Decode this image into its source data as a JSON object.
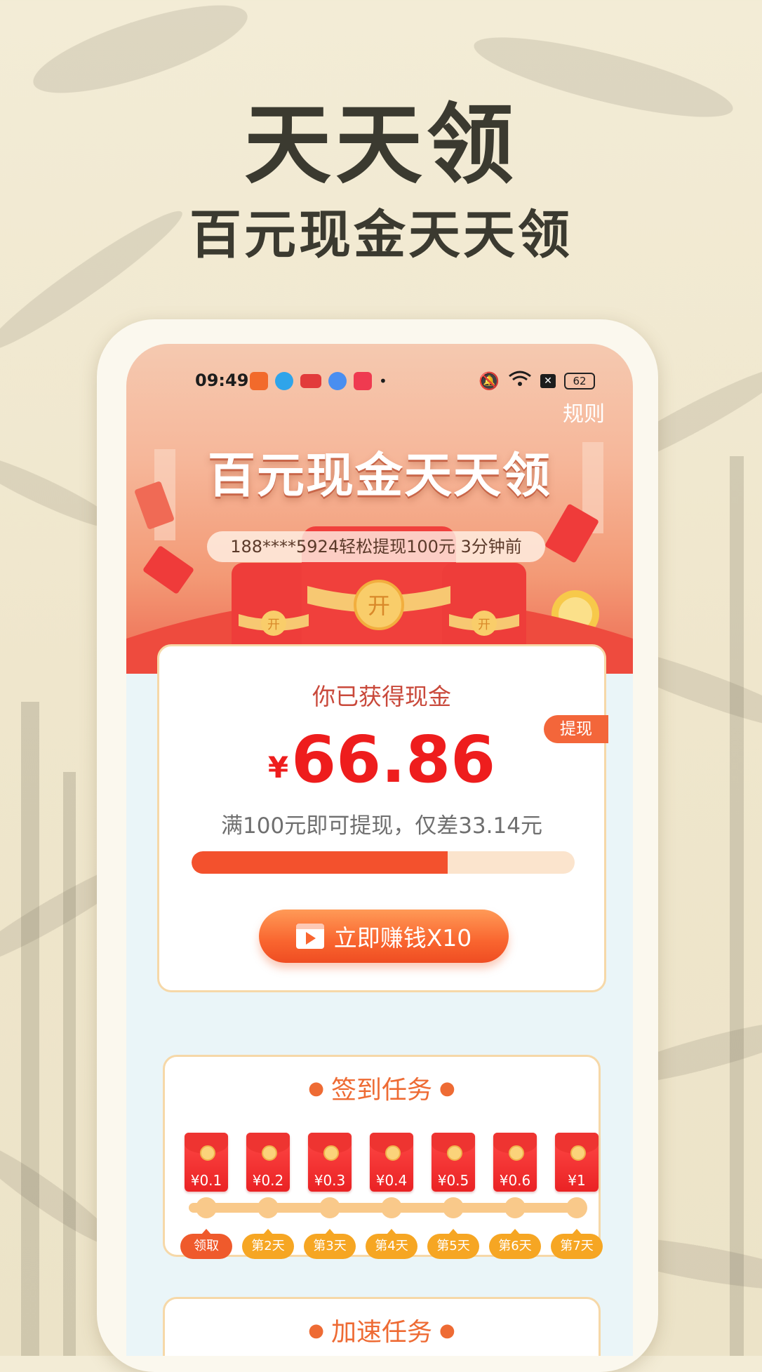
{
  "hero": {
    "title": "天天领",
    "subtitle": "百元现金天天领"
  },
  "status_bar": {
    "time": "09:49",
    "battery": "62"
  },
  "banner": {
    "rules_label": "规则",
    "title": "百元现金天天领",
    "ticker": "188****5924轻松提现100元 3分钟前"
  },
  "cash": {
    "label": "你已获得现金",
    "currency": "¥",
    "amount": "66.86",
    "withdraw_label": "提现",
    "hint": "满100元即可提现，仅差33.14元",
    "progress": 0.6686,
    "earn_button_label": "立即赚钱X10"
  },
  "sign_in": {
    "title": "签到任务",
    "rewards": [
      "¥0.1",
      "¥0.2",
      "¥0.3",
      "¥0.4",
      "¥0.5",
      "¥0.6",
      "¥1"
    ],
    "days": [
      "领取",
      "第2天",
      "第3天",
      "第4天",
      "第5天",
      "第6天",
      "第7天"
    ]
  },
  "speed_up": {
    "title": "加速任务"
  },
  "colors": {
    "accent": "#ef5a2c",
    "cash_red": "#ee1d1d",
    "gold": "#f6a623"
  }
}
